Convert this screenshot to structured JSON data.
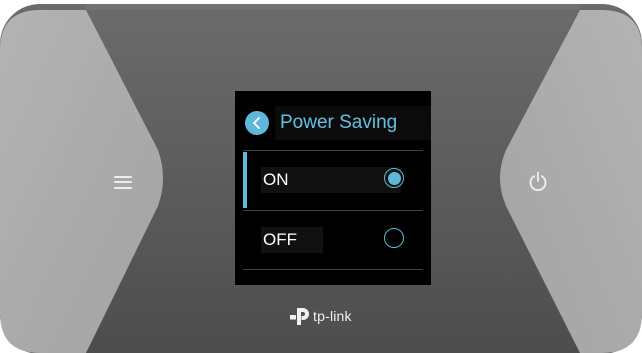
{
  "device": {
    "brand": "tp-link",
    "colors": {
      "body_dark": "#4e4e4e",
      "side_panels": "#a9a9a9",
      "screen": "#000000",
      "accent": "#5fb8d9"
    }
  },
  "buttons": {
    "menu_icon": "hamburger-menu-icon",
    "power_icon": "power-icon"
  },
  "screen": {
    "back_icon": "chevron-left-icon",
    "title": "Power Saving",
    "options": [
      {
        "label": "ON",
        "selected": true
      },
      {
        "label": "OFF",
        "selected": false
      }
    ]
  }
}
